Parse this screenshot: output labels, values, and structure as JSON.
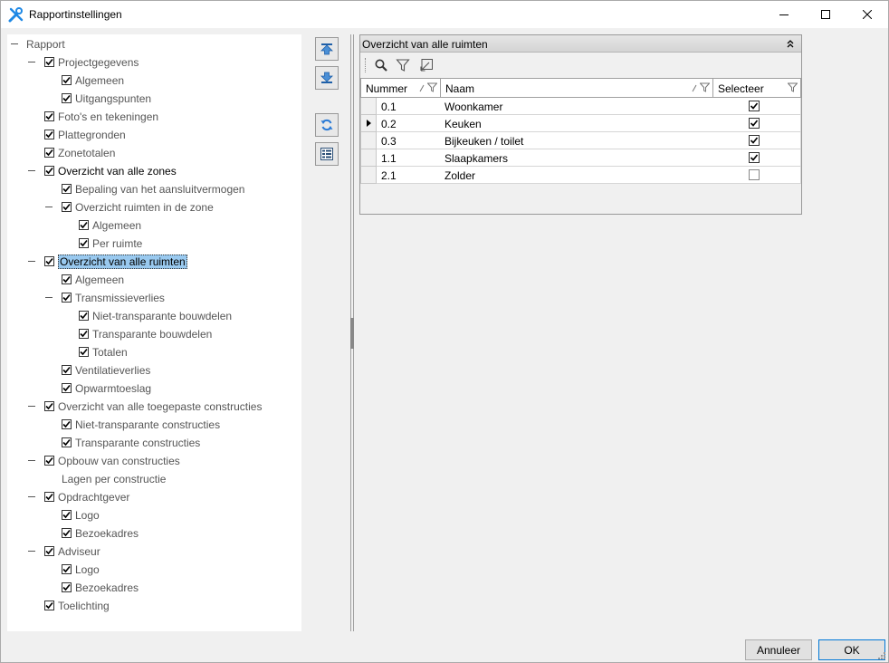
{
  "window": {
    "title": "Rapportinstellingen",
    "icon": "tools-icon",
    "controls": [
      "minimize-icon",
      "maximize-icon",
      "close-icon"
    ]
  },
  "tree": {
    "items": [
      {
        "label": "Rapport",
        "checked": null,
        "expander": true,
        "dark": false,
        "selected": false
      },
      {
        "label": "Projectgegevens",
        "checked": true,
        "expander": true,
        "dark": false,
        "selected": false
      },
      {
        "label": "Algemeen",
        "checked": true,
        "expander": false,
        "dark": false,
        "selected": false
      },
      {
        "label": "Uitgangspunten",
        "checked": true,
        "expander": false,
        "dark": false,
        "selected": false
      },
      {
        "label": "Foto's en tekeningen",
        "checked": true,
        "expander": false,
        "dark": false,
        "selected": false
      },
      {
        "label": "Plattegronden",
        "checked": true,
        "expander": false,
        "dark": false,
        "selected": false
      },
      {
        "label": "Zonetotalen",
        "checked": true,
        "expander": false,
        "dark": false,
        "selected": false
      },
      {
        "label": "Overzicht van alle zones",
        "checked": true,
        "expander": true,
        "dark": true,
        "selected": false
      },
      {
        "label": "Bepaling van het aansluitvermogen",
        "checked": true,
        "expander": false,
        "dark": false,
        "selected": false
      },
      {
        "label": "Overzicht ruimten in de zone",
        "checked": true,
        "expander": true,
        "dark": false,
        "selected": false
      },
      {
        "label": "Algemeen",
        "checked": true,
        "expander": false,
        "dark": false,
        "selected": false
      },
      {
        "label": "Per ruimte",
        "checked": true,
        "expander": false,
        "dark": false,
        "selected": false
      },
      {
        "label": "Overzicht van alle ruimten",
        "checked": true,
        "expander": true,
        "dark": true,
        "selected": true
      },
      {
        "label": "Algemeen",
        "checked": true,
        "expander": false,
        "dark": false,
        "selected": false
      },
      {
        "label": "Transmissieverlies",
        "checked": true,
        "expander": true,
        "dark": false,
        "selected": false
      },
      {
        "label": "Niet-transparante bouwdelen",
        "checked": true,
        "expander": false,
        "dark": false,
        "selected": false
      },
      {
        "label": "Transparante bouwdelen",
        "checked": true,
        "expander": false,
        "dark": false,
        "selected": false
      },
      {
        "label": "Totalen",
        "checked": true,
        "expander": false,
        "dark": false,
        "selected": false
      },
      {
        "label": "Ventilatieverlies",
        "checked": true,
        "expander": false,
        "dark": false,
        "selected": false
      },
      {
        "label": "Opwarmtoeslag",
        "checked": true,
        "expander": false,
        "dark": false,
        "selected": false
      },
      {
        "label": "Overzicht van alle toegepaste constructies",
        "checked": true,
        "expander": true,
        "dark": false,
        "selected": false
      },
      {
        "label": "Niet-transparante constructies",
        "checked": true,
        "expander": false,
        "dark": false,
        "selected": false
      },
      {
        "label": "Transparante constructies",
        "checked": true,
        "expander": false,
        "dark": false,
        "selected": false
      },
      {
        "label": "Opbouw van constructies",
        "checked": true,
        "expander": true,
        "dark": false,
        "selected": false
      },
      {
        "label": "Lagen per constructie",
        "checked": null,
        "expander": false,
        "dark": false,
        "selected": false
      },
      {
        "label": "Opdrachtgever",
        "checked": true,
        "expander": true,
        "dark": false,
        "selected": false
      },
      {
        "label": "Logo",
        "checked": true,
        "expander": false,
        "dark": false,
        "selected": false
      },
      {
        "label": "Bezoekadres",
        "checked": true,
        "expander": false,
        "dark": false,
        "selected": false
      },
      {
        "label": "Adviseur",
        "checked": true,
        "expander": true,
        "dark": false,
        "selected": false
      },
      {
        "label": "Logo",
        "checked": true,
        "expander": false,
        "dark": false,
        "selected": false
      },
      {
        "label": "Bezoekadres",
        "checked": true,
        "expander": false,
        "dark": false,
        "selected": false
      },
      {
        "label": "Toelichting",
        "checked": true,
        "expander": false,
        "dark": false,
        "selected": false
      }
    ]
  },
  "side_buttons": [
    "move-up-icon",
    "move-down-icon",
    "refresh-icon",
    "list-settings-icon"
  ],
  "grid": {
    "title": "Overzicht van alle ruimten",
    "toolbar": [
      "search-icon",
      "filter-icon",
      "clear-filter-icon"
    ],
    "columns": [
      "Nummer",
      "Naam",
      "Selecteer"
    ],
    "rows": [
      {
        "nummer": "0.1",
        "naam": "Woonkamer",
        "selecteer": true,
        "current": false
      },
      {
        "nummer": "0.2",
        "naam": "Keuken",
        "selecteer": true,
        "current": true
      },
      {
        "nummer": "0.3",
        "naam": "Bijkeuken / toilet",
        "selecteer": true,
        "current": false
      },
      {
        "nummer": "1.1",
        "naam": "Slaapkamers",
        "selecteer": true,
        "current": false
      },
      {
        "nummer": "2.1",
        "naam": "Zolder",
        "selecteer": false,
        "current": false
      }
    ]
  },
  "buttons": {
    "cancel": "Annuleer",
    "ok": "OK"
  },
  "colors": {
    "selection": "#99c9ef",
    "accent": "#0078d7",
    "app_icon": "#1e88e5"
  }
}
